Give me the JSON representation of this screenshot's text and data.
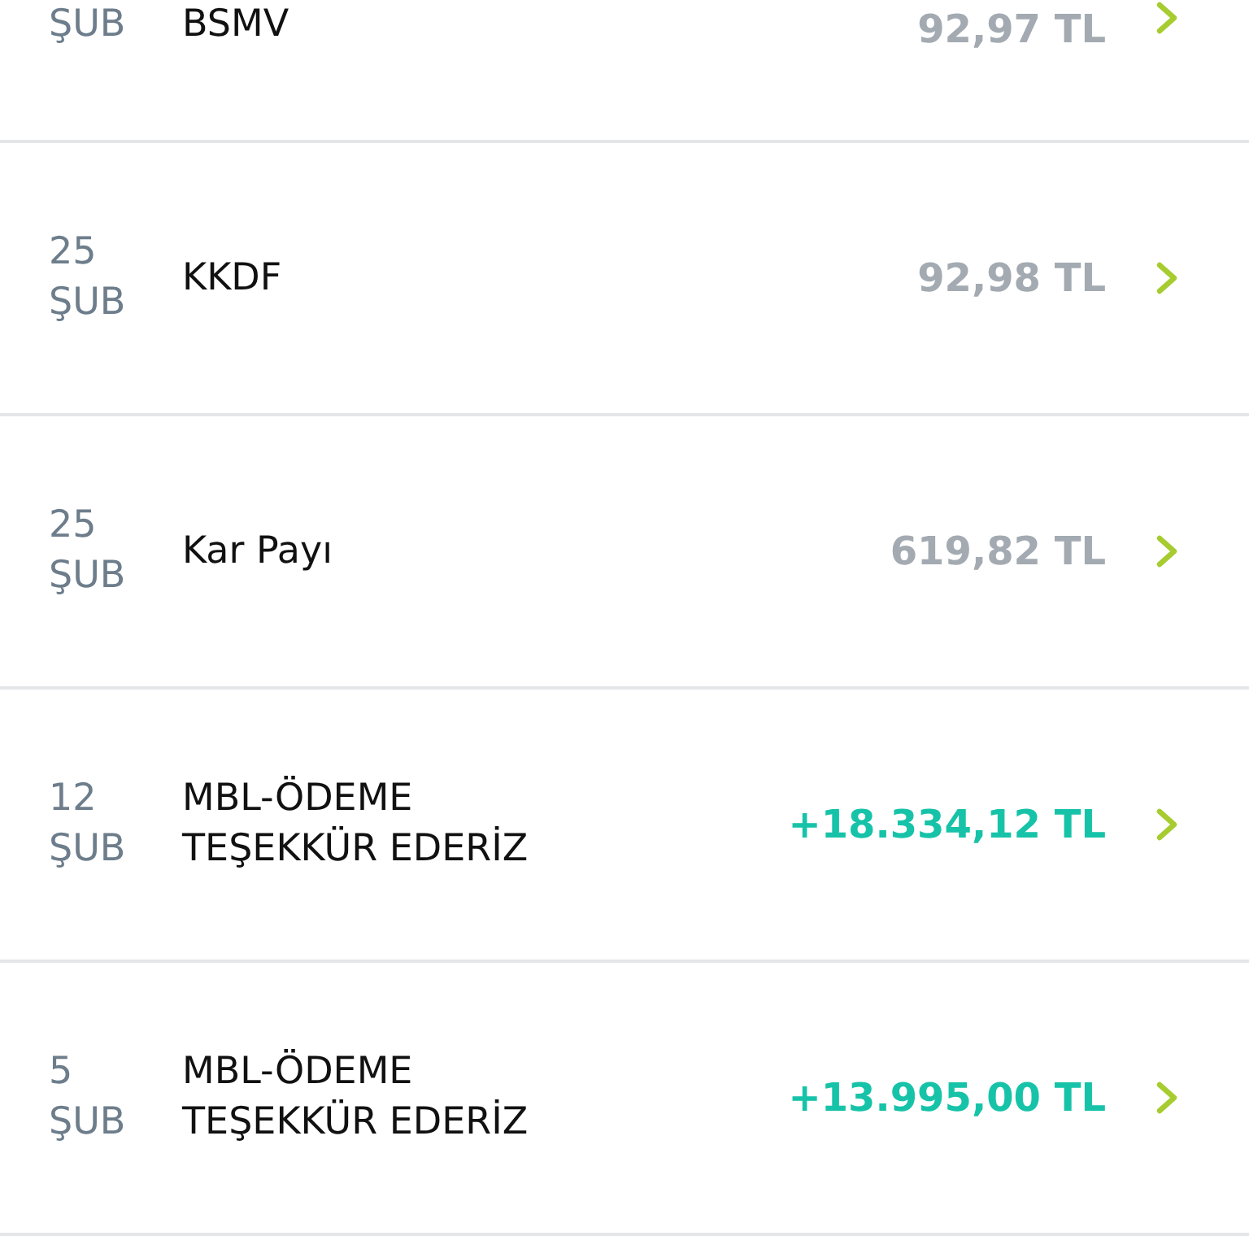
{
  "transactions": [
    {
      "month": "ŞUB",
      "title": "BSMV",
      "amount": "92,97 TL",
      "kind": "debit"
    },
    {
      "day": "25",
      "month": "ŞUB",
      "title": "KKDF",
      "amount": "92,98 TL",
      "kind": "debit"
    },
    {
      "day": "25",
      "month": "ŞUB",
      "title": "Kar Payı",
      "amount": "619,82 TL",
      "kind": "debit"
    },
    {
      "day": "12",
      "month": "ŞUB",
      "title": "MBL-ÖDEME TEŞEKKÜR EDERİZ",
      "amount": "+18.334,12 TL",
      "kind": "credit"
    },
    {
      "day": "5",
      "month": "ŞUB",
      "title": "MBL-ÖDEME TEŞEKKÜR EDERİZ",
      "amount": "+13.995,00 TL",
      "kind": "credit"
    }
  ]
}
